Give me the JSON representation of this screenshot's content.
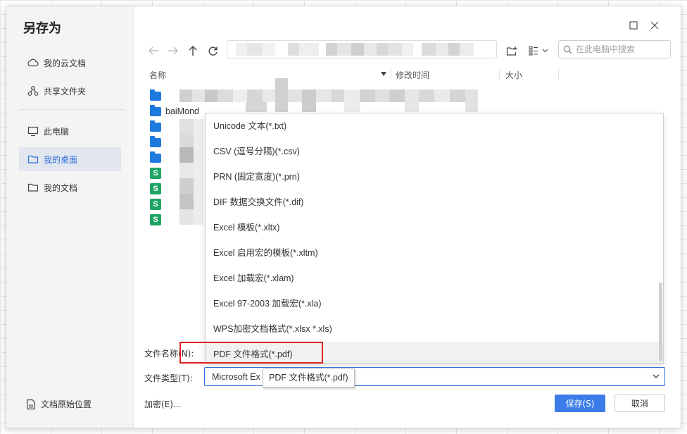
{
  "dialog": {
    "title": "另存为"
  },
  "sidebar": {
    "items": [
      {
        "label": "我的云文档",
        "icon": "cloud-icon"
      },
      {
        "label": "共享文件夹",
        "icon": "share-icon"
      },
      {
        "label": "此电脑",
        "icon": "monitor-icon"
      },
      {
        "label": "我的桌面",
        "icon": "folder-icon",
        "active": true
      },
      {
        "label": "我的文档",
        "icon": "folder-icon"
      }
    ],
    "original_location": "文档原始位置"
  },
  "toolbar": {
    "search_placeholder": "在此电脑中搜索"
  },
  "columns": {
    "name": "名称",
    "modified": "修改时间",
    "size": "大小"
  },
  "files": {
    "row2_visible_text": "baiMond"
  },
  "dropdown": {
    "items": [
      "Unicode 文本(*.txt)",
      "CSV (逗号分隔)(*.csv)",
      "PRN (固定宽度)(*.prn)",
      "DIF 数据交换文件(*.dif)",
      "Excel 模板(*.xltx)",
      "Excel 启用宏的模板(*.xltm)",
      "Excel 加载宏(*.xlam)",
      "Excel 97-2003 加载宏(*.xla)",
      "WPS加密文档格式(*.xlsx *.xls)",
      "PDF 文件格式(*.pdf)"
    ],
    "hovered_index": 9
  },
  "form": {
    "filename_label": "文件名称(N):",
    "filetype_label": "文件类型(T):",
    "filetype_value": "Microsoft Ex",
    "tooltip": "PDF 文件格式(*.pdf)"
  },
  "footer": {
    "encrypt_label": "加密(E)...",
    "save_label": "保存(S)",
    "cancel_label": "取消"
  },
  "colors": {
    "accent": "#3b7ce8",
    "highlight_box": "#e02020",
    "folder": "#1f7ae0",
    "spreadsheet": "#1fa463"
  }
}
